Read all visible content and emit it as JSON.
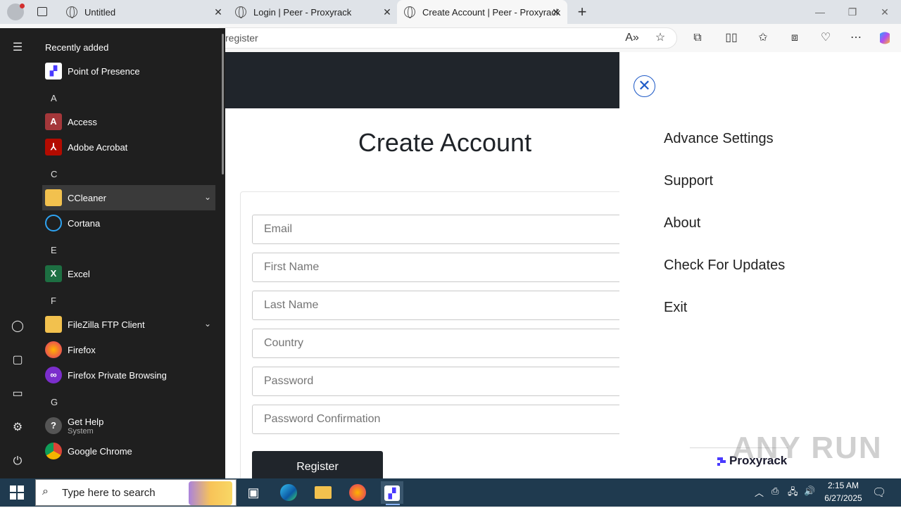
{
  "browser": {
    "tabs": [
      {
        "title": "Untitled"
      },
      {
        "title": "Login | Peer - Proxyrack"
      },
      {
        "title": "Create Account | Peer - Proxyrack"
      }
    ],
    "new_tab": "+",
    "url": "register"
  },
  "page": {
    "title": "Create Account",
    "fields": [
      {
        "placeholder": "Email"
      },
      {
        "placeholder": "First Name"
      },
      {
        "placeholder": "Last Name"
      },
      {
        "placeholder": "Country"
      },
      {
        "placeholder": "Password"
      },
      {
        "placeholder": "Password Confirmation"
      }
    ],
    "register_label": "Register"
  },
  "side_menu": {
    "items": [
      "Advance Settings",
      "Support",
      "About",
      "Check For Updates",
      "Exit"
    ],
    "brand": "Proxyrack",
    "accent": "#1e5ac7"
  },
  "start_menu": {
    "recent_title": "Recently added",
    "recent_apps": [
      {
        "label": "Point of Presence"
      }
    ],
    "letters": [
      "A",
      "C",
      "E",
      "F",
      "G"
    ],
    "apps": [
      {
        "label": "Access",
        "icon": "access-icon"
      },
      {
        "label": "Adobe Acrobat",
        "icon": "acrobat-icon"
      },
      {
        "label": "CCleaner",
        "icon": "folder-icon"
      },
      {
        "label": "Cortana",
        "icon": "cortana-icon"
      },
      {
        "label": "Excel",
        "icon": "excel-icon"
      },
      {
        "label": "FileZilla FTP Client",
        "icon": "folder-icon"
      },
      {
        "label": "Firefox",
        "icon": "firefox-icon"
      },
      {
        "label": "Firefox Private Browsing",
        "icon": "firefox-private-icon"
      },
      {
        "label": "Get Help",
        "sublabel": "System",
        "icon": "help-icon"
      },
      {
        "label": "Google Chrome",
        "icon": "chrome-icon"
      }
    ]
  },
  "taskbar": {
    "search_placeholder": "Type here to search",
    "time": "2:15 AM",
    "date": "6/27/2025"
  },
  "watermark": "ANY RUN"
}
